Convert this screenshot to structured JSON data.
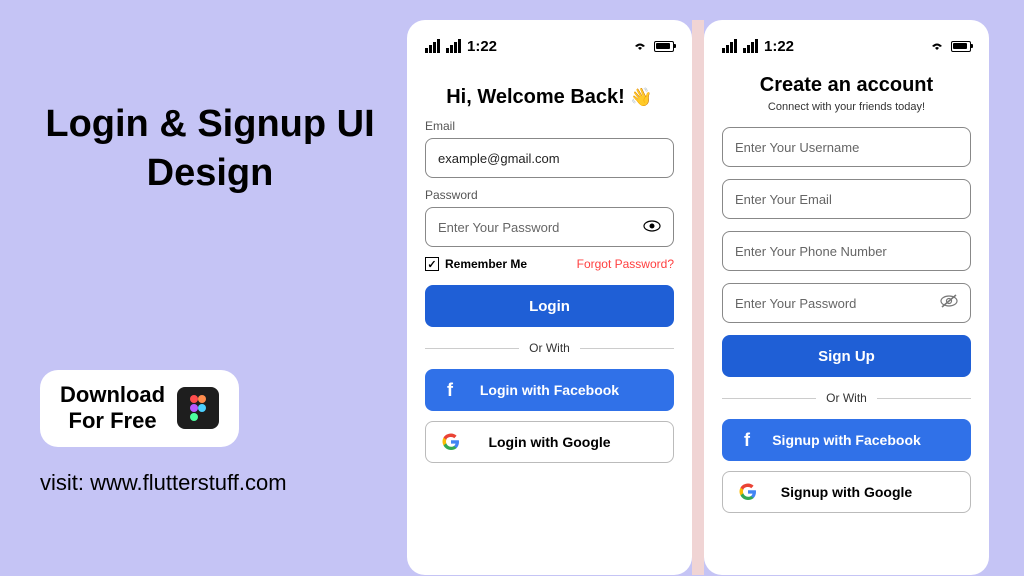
{
  "promo": {
    "title": "Login & Signup UI Design",
    "download_line1": "Download",
    "download_line2": "For Free",
    "visit": "visit: www.flutterstuff.com"
  },
  "status": {
    "time": "1:22"
  },
  "login": {
    "title": "Hi, Welcome Back!",
    "wave": "👋",
    "email_label": "Email",
    "email_value": "example@gmail.com",
    "password_label": "Password",
    "password_placeholder": "Enter Your Password",
    "remember": "Remember Me",
    "forgot": "Forgot Password?",
    "login_btn": "Login",
    "or_with": "Or With",
    "fb_btn": "Login with Facebook",
    "google_btn": "Login with Google"
  },
  "signup": {
    "title": "Create an account",
    "subtitle": "Connect with your friends today!",
    "username_placeholder": "Enter Your Username",
    "email_placeholder": "Enter Your Email",
    "phone_placeholder": "Enter Your Phone Number",
    "password_placeholder": "Enter Your Password",
    "signup_btn": "Sign Up",
    "or_with": "Or With",
    "fb_btn": "Signup with Facebook",
    "google_btn": "Signup with Google"
  }
}
